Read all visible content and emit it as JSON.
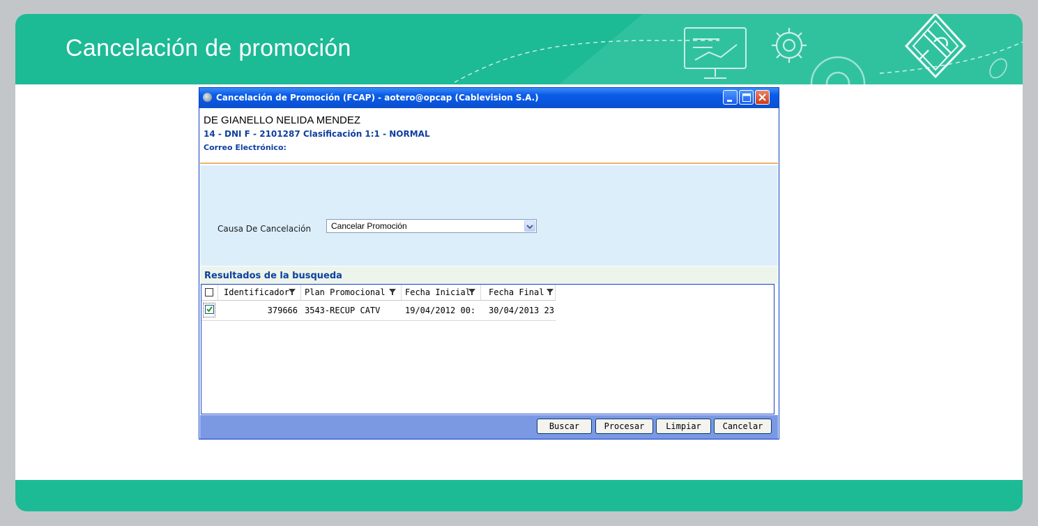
{
  "slide": {
    "title": "Cancelación de promoción"
  },
  "window": {
    "title": "Cancelación de Promoción (FCAP) - aotero@opcap (Cablevision S.A.)",
    "customer_name": "DE GIANELLO NELIDA  MENDEZ",
    "customer_line": "14 - DNI F - 2101287 Clasificación 1:1 - NORMAL",
    "email_label": "Correo Electrónico:"
  },
  "form": {
    "cause_label": "Causa De Cancelación",
    "cause_value": "Cancelar Promoción"
  },
  "results": {
    "title": "Resultados de la busqueda",
    "columns": [
      "Identificador",
      "Plan Promocional",
      "Fecha Inicial",
      "Fecha Final"
    ],
    "rows": [
      {
        "selected": true,
        "cells": [
          "379666",
          "3543-RECUP CATV",
          "19/04/2012 00:",
          "30/04/2013 23"
        ]
      }
    ]
  },
  "buttons": {
    "buscar": "Buscar",
    "procesar": "Procesar",
    "limpiar": "Limpiar",
    "cancelar": "Cancelar"
  },
  "colors": {
    "brand": "#1dba96",
    "titlebar": "#0a54dc",
    "label_blue": "#0f3fa0",
    "form_bg": "#ddeefb",
    "button_bar": "#7b98e3"
  }
}
